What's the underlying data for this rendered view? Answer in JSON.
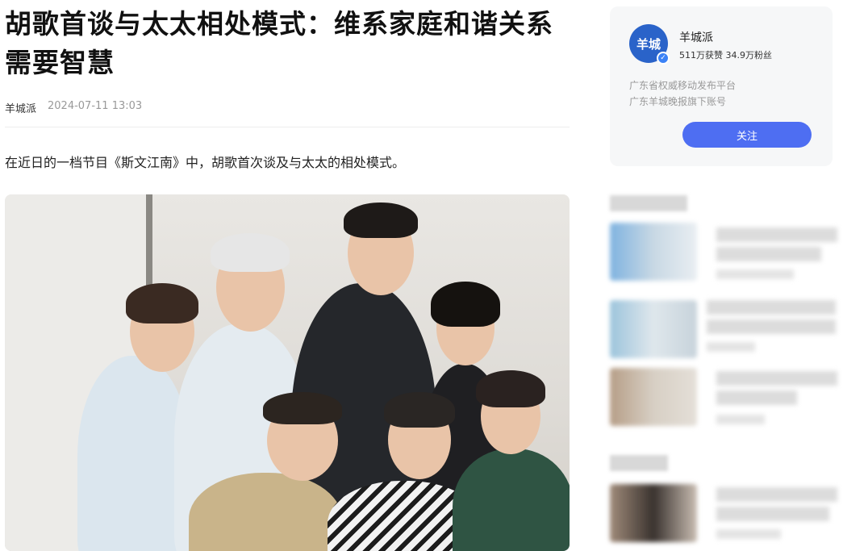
{
  "article": {
    "title": "胡歌首谈与太太相处模式：维系家庭和谐关系需要智慧",
    "author": "羊城派",
    "date": "2024-07-11 13:03",
    "lead": "在近日的一档节目《斯文江南》中，胡歌首次谈及与太太的相处模式。"
  },
  "sidebar": {
    "author_name": "羊城派",
    "avatar_text": "羊城",
    "stats": "511万获赞 34.9万粉丝",
    "desc_line1": "广东省权威移动发布平台",
    "desc_line2": "广东羊城晚报旗下账号",
    "follow_label": "关注"
  },
  "colors": {
    "accent": "#4e6ef2",
    "avatar_bg": "#2a63c9"
  }
}
